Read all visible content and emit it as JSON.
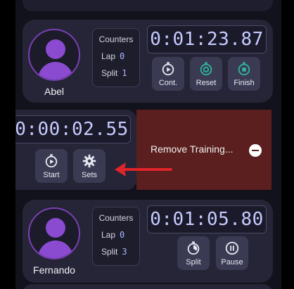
{
  "cards": [
    {
      "name": "Abel",
      "counters": {
        "title": "Counters",
        "lap_label": "Lap",
        "lap_value": "0",
        "split_label": "Split",
        "split_value": "1"
      },
      "timer": "0:01:23.87",
      "buttons": [
        {
          "label": "Cont.",
          "icon": "stopwatch-icon"
        },
        {
          "label": "Reset",
          "icon": "reset-stopwatch-icon"
        },
        {
          "label": "Finish",
          "icon": "finish-stopwatch-icon"
        }
      ]
    },
    {
      "name": "",
      "timer": "0:00:02.55",
      "buttons": [
        {
          "label": "Start",
          "icon": "play-stopwatch-icon"
        },
        {
          "label": "Sets",
          "icon": "gear-icon"
        }
      ],
      "remove_label": "Remove Training...",
      "remove_icon": "minus-circle-icon"
    },
    {
      "name": "Fernando",
      "counters": {
        "title": "Counters",
        "lap_label": "Lap",
        "lap_value": "0",
        "split_label": "Split",
        "split_value": "3"
      },
      "timer": "0:01:05.80",
      "buttons": [
        {
          "label": "Split",
          "icon": "split-stopwatch-icon"
        },
        {
          "label": "Pause",
          "icon": "pause-icon"
        }
      ]
    }
  ],
  "colors": {
    "accent_purple": "#8a4bd0",
    "timer_text": "#c7cbff",
    "teal_icon": "#2fb59c",
    "remove_bg": "#5a1f1e",
    "arrow_red": "#e0242a"
  }
}
